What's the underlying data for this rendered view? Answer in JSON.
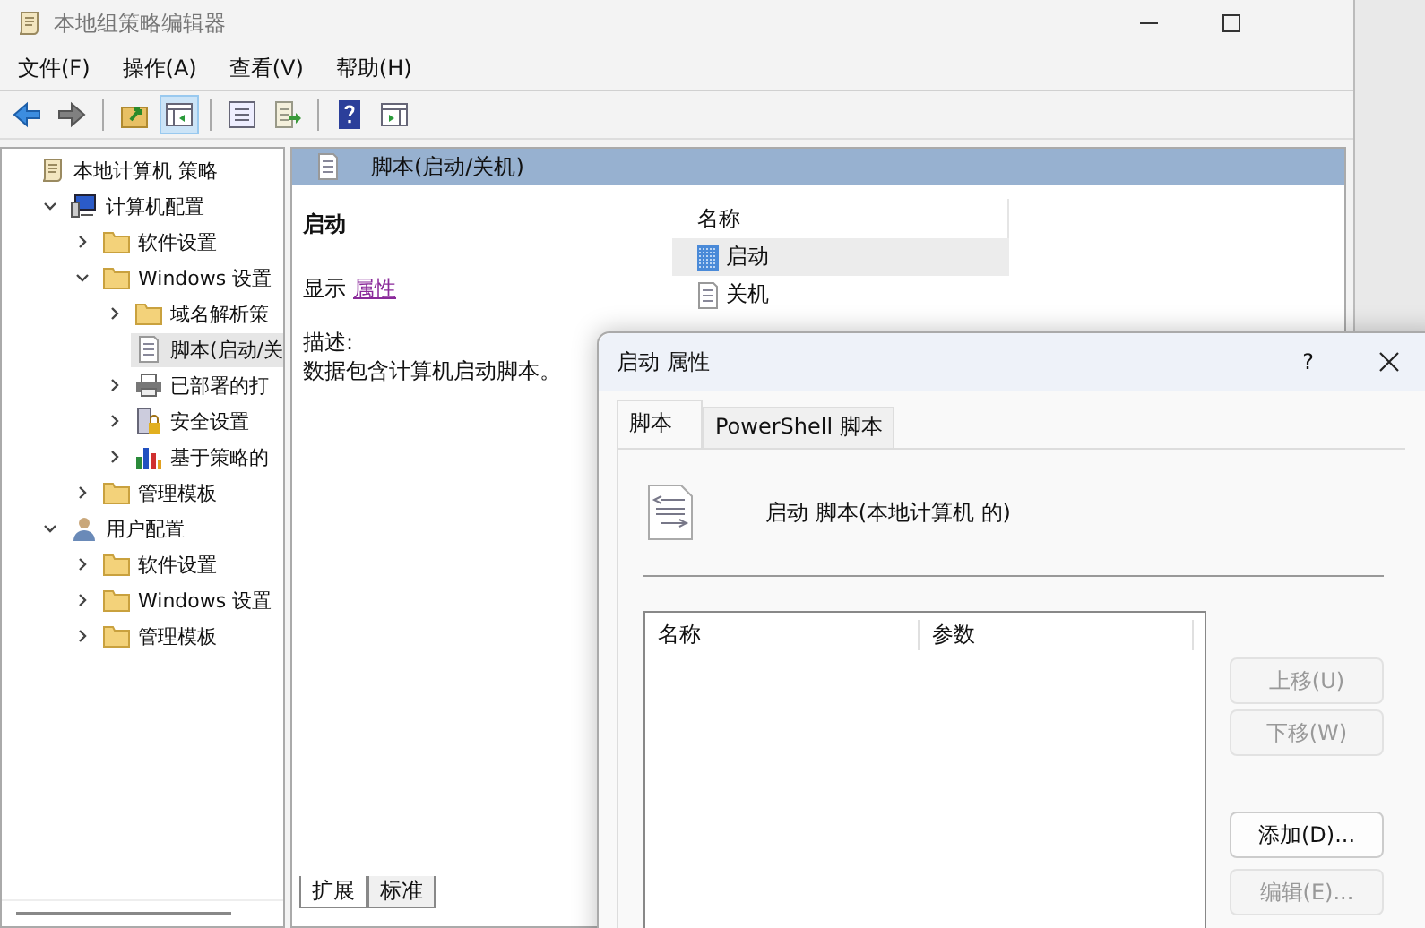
{
  "window": {
    "title": "本地组策略编辑器"
  },
  "menu": [
    "文件(F)",
    "操作(A)",
    "查看(V)",
    "帮助(H)"
  ],
  "tree": [
    {
      "label": "本地计算机 策略",
      "kind": "policy",
      "selected": false,
      "children": [
        {
          "label": "计算机配置",
          "kind": "computer",
          "selected": false,
          "expanded": true,
          "children": [
            {
              "label": "软件设置",
              "kind": "folder",
              "selected": false,
              "expanded": false
            },
            {
              "label": "Windows 设置",
              "kind": "folder",
              "selected": false,
              "expanded": true,
              "children": [
                {
                  "label": "域名解析策",
                  "kind": "folder",
                  "selected": false,
                  "expanded": false
                },
                {
                  "label": "脚本(启动/关",
                  "kind": "script",
                  "selected": true
                },
                {
                  "label": "已部署的打",
                  "kind": "printer",
                  "selected": false,
                  "expanded": false
                },
                {
                  "label": "安全设置",
                  "kind": "security",
                  "selected": false,
                  "expanded": false
                },
                {
                  "label": "基于策略的",
                  "kind": "chart",
                  "selected": false,
                  "expanded": false
                }
              ]
            },
            {
              "label": "管理模板",
              "kind": "folder",
              "selected": false,
              "expanded": false
            }
          ]
        },
        {
          "label": "用户配置",
          "kind": "user",
          "selected": false,
          "expanded": true,
          "children": [
            {
              "label": "软件设置",
              "kind": "folder",
              "selected": false,
              "expanded": false
            },
            {
              "label": "Windows 设置",
              "kind": "folder",
              "selected": false,
              "expanded": false
            },
            {
              "label": "管理模板",
              "kind": "folder",
              "selected": false,
              "expanded": false
            }
          ]
        }
      ]
    }
  ],
  "details": {
    "title": "脚本(启动/关机)",
    "heading": "启动",
    "show_label": "显示",
    "show_link": "属性",
    "description_label": "描述:",
    "description": "数据包含计算机启动脚本。"
  },
  "list": {
    "column": "名称",
    "items": [
      {
        "label": "启动",
        "kind": "startup",
        "selected": true
      },
      {
        "label": "关机",
        "kind": "script",
        "selected": false
      }
    ]
  },
  "view_tabs": [
    {
      "label": "扩展",
      "selected": true
    },
    {
      "label": "标准",
      "selected": false
    }
  ],
  "dialog": {
    "title": "启动 属性",
    "help": "?",
    "tabs": [
      {
        "label": "脚本",
        "selected": true
      },
      {
        "label": "PowerShell 脚本",
        "selected": false
      }
    ],
    "header": "启动 脚本(本地计算机 的)",
    "columns": [
      "名称",
      "参数"
    ],
    "buttons": [
      {
        "label": "上移(U)",
        "disabled": true
      },
      {
        "label": "下移(W)",
        "disabled": true
      },
      {
        "label": "添加(D)...",
        "disabled": false
      },
      {
        "label": "编辑(E)...",
        "disabled": true
      }
    ]
  }
}
